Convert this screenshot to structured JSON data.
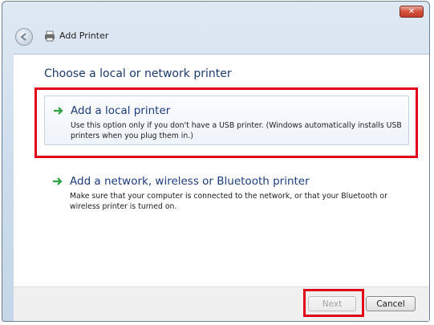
{
  "window": {
    "title": "Add Printer",
    "close_glyph": "✕",
    "back_icon": "back-arrow-icon",
    "title_icon": "printer-icon"
  },
  "page": {
    "heading": "Choose a local or network printer",
    "options": [
      {
        "icon": "green-arrow-icon",
        "title": "Add a local printer",
        "description": "Use this option only if you don't have a USB printer. (Windows automatically installs USB printers when you plug them in.)"
      },
      {
        "icon": "green-arrow-icon",
        "title": "Add a network, wireless or Bluetooth printer",
        "description": "Make sure that your computer is connected to the network, or that your Bluetooth or wireless printer is turned on."
      }
    ]
  },
  "footer": {
    "next_label": "Next",
    "next_enabled": false,
    "cancel_label": "Cancel"
  },
  "annotations": {
    "highlight_color": "#e0001a"
  },
  "colors": {
    "heading": "#1e3a6a",
    "option_title": "#1d3d7c",
    "arrow": "#2ea043"
  }
}
